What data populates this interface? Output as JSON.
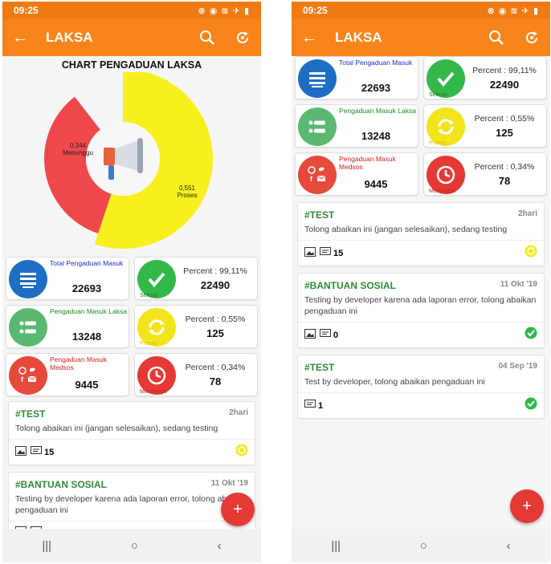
{
  "status": {
    "time": "09:25",
    "icons": "⊗ ◉ ≋ ✈ ▮"
  },
  "appbar": {
    "back": "←",
    "title": "LAKSA"
  },
  "chart_data": {
    "type": "pie",
    "title": "CHART PENGADUAN LAKSA",
    "categories": [
      "Menunggu",
      "Proses",
      "Selesai"
    ],
    "values": [
      0.344,
      0.551,
      0.105
    ],
    "value_labels": [
      "0,344",
      "0,551",
      ""
    ],
    "colors": [
      "#f0474a",
      "#f7f01e",
      "#f5f5f5"
    ]
  },
  "cards": {
    "total": {
      "label": "Total Pengaduan Masuk",
      "value": "22693",
      "color": "#1e6fc4"
    },
    "selesai": {
      "pct": "Percent : 99,11%",
      "value": "22490",
      "sub": "Selesai",
      "color": "#33b84a"
    },
    "laksa": {
      "label": "Pengaduan Masuk Laksa",
      "value": "13248",
      "color": "#5bb870"
    },
    "proses": {
      "pct": "Percent : 0,55%",
      "value": "125",
      "sub": "Proses",
      "color": "#f2e51c"
    },
    "medsos": {
      "label": "Pengaduan Masuk Medsos",
      "value": "9445",
      "color": "#e64a3c"
    },
    "menunggu": {
      "pct": "Percent : 0,34%",
      "value": "78",
      "sub": "Menunggu",
      "color": "#e53935"
    }
  },
  "posts": [
    {
      "tag": "#TEST",
      "date": "2hari",
      "desc": "Tolong abaikan ini (jangan selesaikan), sedang testing",
      "count": "15",
      "status": "proses"
    },
    {
      "tag": "#BANTUAN SOSIAL",
      "date": "11 Okt '19",
      "desc": "Testing by developer karena ada laporan error, tolong abaikan pengaduan ini",
      "count": "0",
      "status": "selesai"
    },
    {
      "tag": "#TEST",
      "date": "04 Sep '19",
      "desc": "Test by developer, tolong abaikan pengaduan ini",
      "count": "1",
      "status": "selesai"
    }
  ],
  "nav": {
    "recent": "|||",
    "home": "○",
    "back": "‹"
  },
  "fab": "+"
}
